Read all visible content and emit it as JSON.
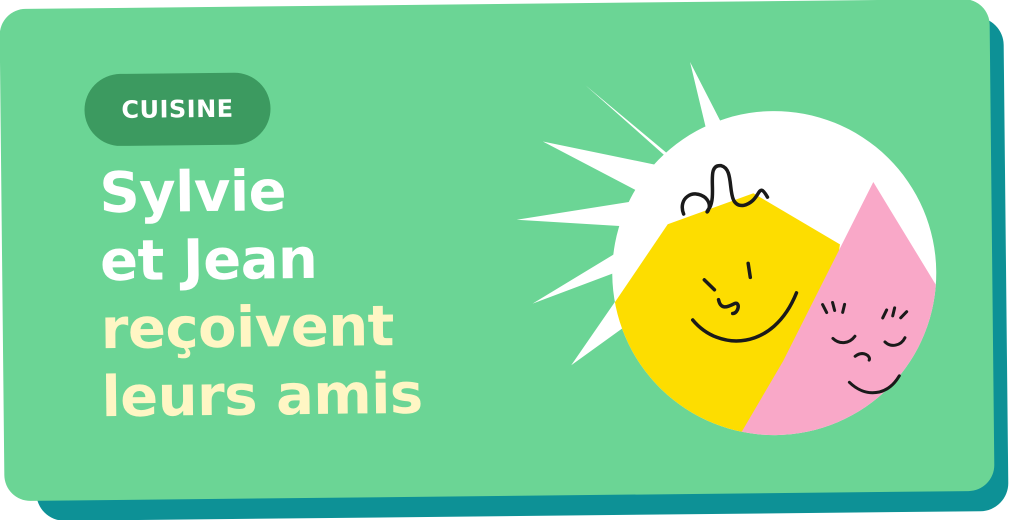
{
  "category": {
    "label": "CUISINE"
  },
  "headline": {
    "line1": "Sylvie",
    "line2": "et Jean",
    "line3": "reçoivent",
    "line4": "leurs amis"
  },
  "colors": {
    "card_background": "#6bd595",
    "card_shadow": "#0d9196",
    "badge_background": "#3c9a60",
    "title_white": "#ffffff",
    "title_cream": "#fff6c4",
    "sun_yellow": "#fddd00",
    "triangle_pink": "#f9a8c8",
    "circle_white": "#ffffff",
    "face_lines": "#1a1a1a"
  },
  "illustration": {
    "icons": [
      "sunburst-icon",
      "smiling-hexagon-face-icon",
      "smiling-triangle-face-icon"
    ]
  }
}
